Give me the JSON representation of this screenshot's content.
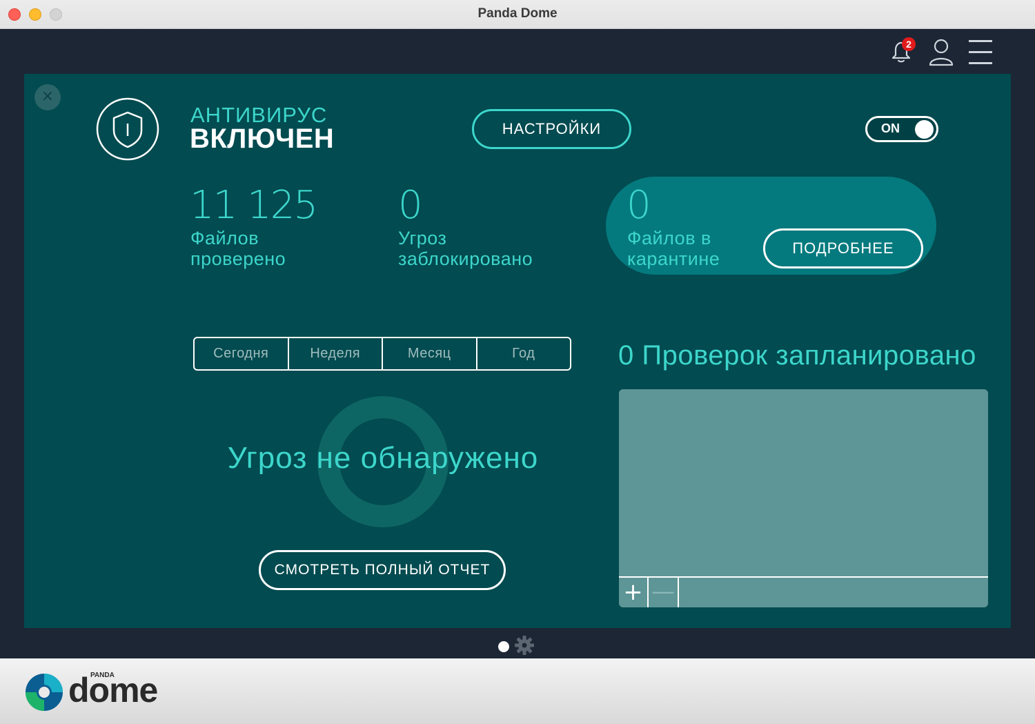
{
  "window": {
    "title": "Panda Dome"
  },
  "header": {
    "notification_count": "2"
  },
  "antivirus": {
    "label": "АНТИВИРУС",
    "status": "ВКЛЮЧЕН",
    "settings_button": "НАСТРОЙКИ",
    "toggle_label": "ON"
  },
  "stats": {
    "files_scanned": {
      "value": "11 125",
      "label_line1": "Файлов",
      "label_line2": "проверено"
    },
    "threats_blocked": {
      "value": "0",
      "label_line1": "Угроз",
      "label_line2": "заблокировано"
    },
    "quarantine": {
      "value": "0",
      "label_line1": "Файлов в",
      "label_line2": "карантине",
      "button": "ПОДРОБНЕЕ"
    }
  },
  "period_tabs": [
    "Сегодня",
    "Неделя",
    "Месяц",
    "Год"
  ],
  "summary": {
    "message": "Угроз не обнаружено",
    "report_button": "СМОТРЕТЬ ПОЛНЫЙ ОТЧЕТ"
  },
  "scheduled": {
    "title": "0 Проверок запланировано",
    "add_symbol": "+",
    "remove_symbol": "—"
  },
  "footer": {
    "brand_small": "PANDA",
    "brand": "dome"
  },
  "colors": {
    "panel": "#024b50",
    "accent": "#3dd6cb",
    "app_bg": "#1c2635",
    "quarantine_bg": "#047a7e",
    "badge": "#e21b1b"
  }
}
